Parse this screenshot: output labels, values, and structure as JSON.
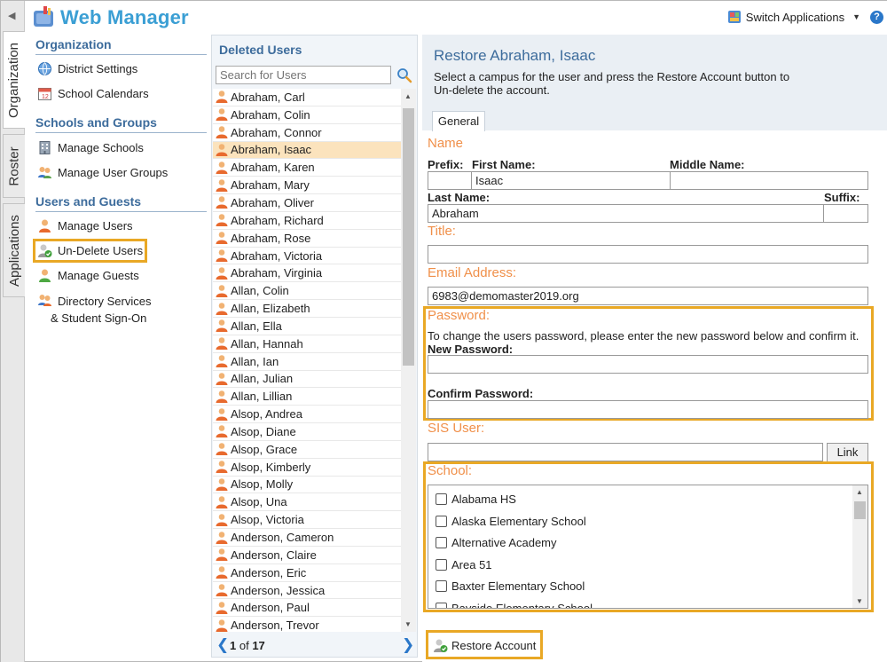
{
  "app": {
    "title": "Web Manager",
    "switch_apps": "Switch Applications",
    "help": "?"
  },
  "vtabs": [
    {
      "label": "Organization",
      "active": true
    },
    {
      "label": "Roster",
      "active": false
    },
    {
      "label": "Applications",
      "active": false
    }
  ],
  "orgnav": {
    "sections": [
      {
        "title": "Organization",
        "items": [
          {
            "label": "District Settings",
            "icon": "globe-icon"
          },
          {
            "label": "School Calendars",
            "icon": "calendar-icon"
          }
        ]
      },
      {
        "title": "Schools and Groups",
        "items": [
          {
            "label": "Manage Schools",
            "icon": "building-icon"
          },
          {
            "label": "Manage User Groups",
            "icon": "group-icon"
          }
        ]
      },
      {
        "title": "Users and Guests",
        "items": [
          {
            "label": "Manage Users",
            "icon": "user-icon"
          },
          {
            "label": "Un-Delete Users",
            "icon": "undelete-user-icon",
            "highlighted": true
          },
          {
            "label": "Manage Guests",
            "icon": "guest-icon"
          },
          {
            "label": "Directory Services",
            "label2": "& Student Sign-On",
            "icon": "directory-icon"
          }
        ]
      }
    ]
  },
  "users_panel": {
    "title": "Deleted Users",
    "search_placeholder": "Search for Users",
    "users": [
      "Abraham, Carl",
      "Abraham, Colin",
      "Abraham, Connor",
      "Abraham, Isaac",
      "Abraham, Karen",
      "Abraham, Mary",
      "Abraham, Oliver",
      "Abraham, Richard",
      "Abraham, Rose",
      "Abraham, Victoria",
      "Abraham, Virginia",
      "Allan, Colin",
      "Allan, Elizabeth",
      "Allan, Ella",
      "Allan, Hannah",
      "Allan, Ian",
      "Allan, Julian",
      "Allan, Lillian",
      "Alsop, Andrea",
      "Alsop, Diane",
      "Alsop, Grace",
      "Alsop, Kimberly",
      "Alsop, Molly",
      "Alsop, Una",
      "Alsop, Victoria",
      "Anderson, Cameron",
      "Anderson, Claire",
      "Anderson, Eric",
      "Anderson, Jessica",
      "Anderson, Paul",
      "Anderson, Trevor"
    ],
    "selected_index": 3,
    "pager": {
      "current": "1",
      "of": "of",
      "total": "17"
    }
  },
  "main": {
    "title": "Restore Abraham, Isaac",
    "description": "Select a campus for the user and press the Restore Account button to Un-delete the account.",
    "tab": "General",
    "name_section": "Name",
    "prefix_label": "Prefix:",
    "first_name_label": "First Name:",
    "middle_name_label": "Middle Name:",
    "last_name_label": "Last Name:",
    "suffix_label": "Suffix:",
    "prefix_value": "",
    "first_name_value": "Isaac",
    "middle_name_value": "",
    "last_name_value": "Abraham",
    "suffix_value": "",
    "title_section": "Title:",
    "title_value": "",
    "email_section": "Email Address:",
    "email_value": "6983@demomaster2019.org",
    "password_section": "Password:",
    "password_help": "To change the users password, please enter the new password below and confirm it.",
    "new_password_label": "New Password:",
    "confirm_password_label": "Confirm Password:",
    "sis_section": "SIS User:",
    "sis_value": "",
    "link_button": "Link",
    "school_section": "School:",
    "schools": [
      "Alabama HS",
      "Alaska Elementary School",
      "Alternative Academy",
      "Area 51",
      "Baxter Elementary School",
      "Bayside Elementary School"
    ],
    "restore_button": "Restore Account"
  },
  "colors": {
    "accent_blue": "#3d6c9c",
    "section_orange": "#f0904a",
    "highlight": "#e9a825",
    "selected_row": "#fbe3bd"
  }
}
